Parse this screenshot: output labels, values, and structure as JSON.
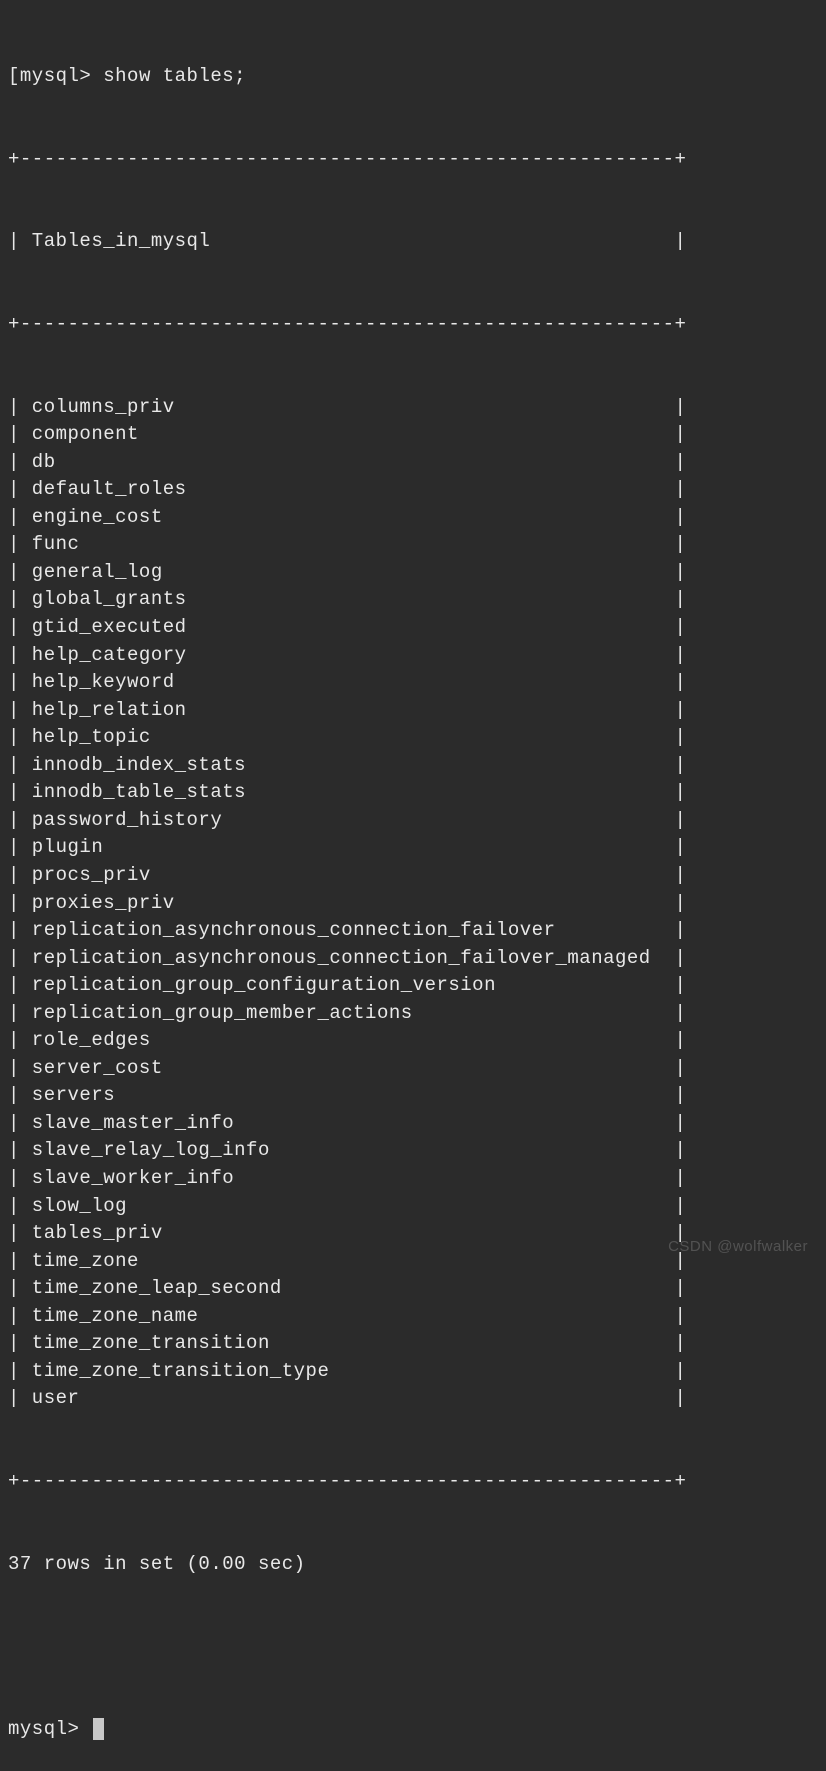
{
  "prompt": "mysql>",
  "left_bracket": "[",
  "command": "show tables;",
  "table_header": "Tables_in_mysql",
  "tables": [
    "columns_priv",
    "component",
    "db",
    "default_roles",
    "engine_cost",
    "func",
    "general_log",
    "global_grants",
    "gtid_executed",
    "help_category",
    "help_keyword",
    "help_relation",
    "help_topic",
    "innodb_index_stats",
    "innodb_table_stats",
    "password_history",
    "plugin",
    "procs_priv",
    "proxies_priv",
    "replication_asynchronous_connection_failover",
    "replication_asynchronous_connection_failover_managed",
    "replication_group_configuration_version",
    "replication_group_member_actions",
    "role_edges",
    "server_cost",
    "servers",
    "slave_master_info",
    "slave_relay_log_info",
    "slave_worker_info",
    "slow_log",
    "tables_priv",
    "time_zone",
    "time_zone_leap_second",
    "time_zone_name",
    "time_zone_transition",
    "time_zone_transition_type",
    "user"
  ],
  "row_count_line": "37 rows in set (0.00 sec)",
  "border_inner_width": 55,
  "watermark1": "CSDN @wolfwalker",
  "watermark2": ""
}
